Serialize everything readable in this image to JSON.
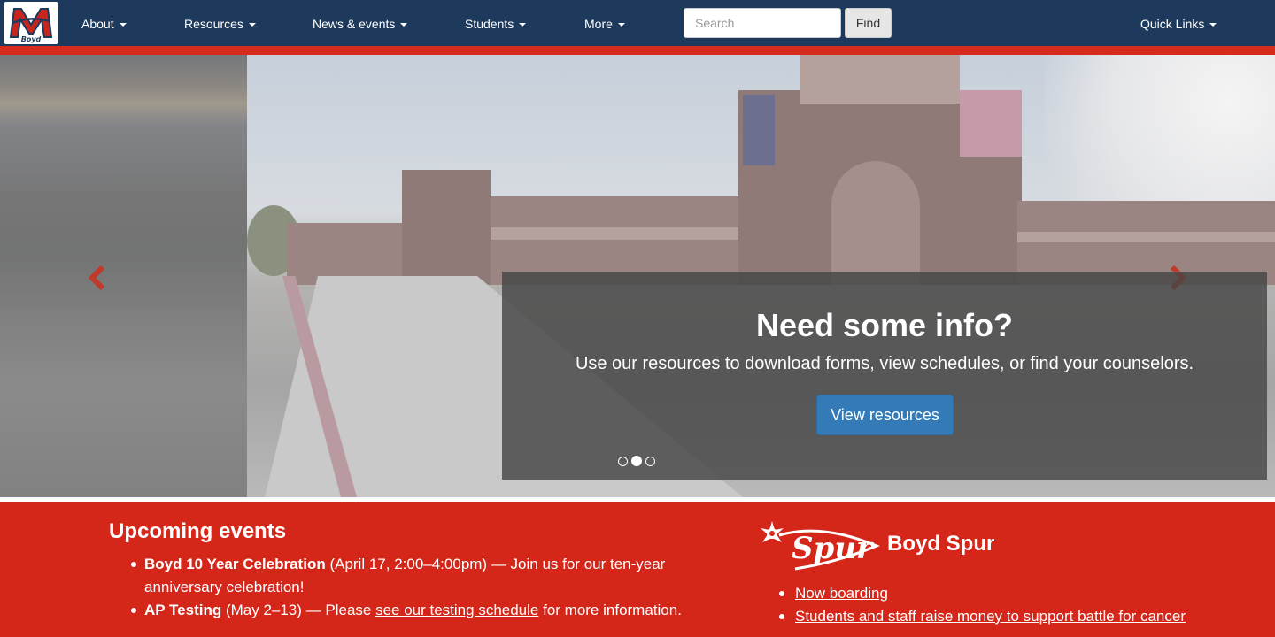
{
  "navbar": {
    "logo_text": "Boyd",
    "items": [
      {
        "label": "About"
      },
      {
        "label": "Resources"
      },
      {
        "label": "News & events"
      },
      {
        "label": "Students"
      },
      {
        "label": "More"
      }
    ],
    "search": {
      "placeholder": "Search",
      "value": ""
    },
    "find_label": "Find",
    "quick_links_label": "Quick Links"
  },
  "hero": {
    "caption_title": "Need some info?",
    "caption_text": "Use our resources to download forms, view schedules, or find your counselors.",
    "button_label": "View resources",
    "prev_icon": "chevron-left-icon",
    "next_icon": "chevron-right-icon",
    "slide_count": 3,
    "active_slide": 2
  },
  "events": {
    "title": "Upcoming events",
    "items": [
      {
        "name": "Boyd 10 Year Celebration",
        "detail": " (April 17, 2:00–4:00pm) — Join us for our ten-year anniversary celebration!"
      },
      {
        "name": "AP Testing",
        "detail_before": " (May 2–13) — Please ",
        "link": "see our testing schedule",
        "detail_after": " for more information."
      }
    ]
  },
  "spur": {
    "logo_text": "Spur",
    "title": "Boyd Spur",
    "links": [
      "Now boarding",
      "Students and staff raise money to support battle for cancer"
    ]
  },
  "colors": {
    "navbar": "#1d3a5c",
    "accent_red": "#d42619",
    "button_blue": "#337ab7"
  }
}
